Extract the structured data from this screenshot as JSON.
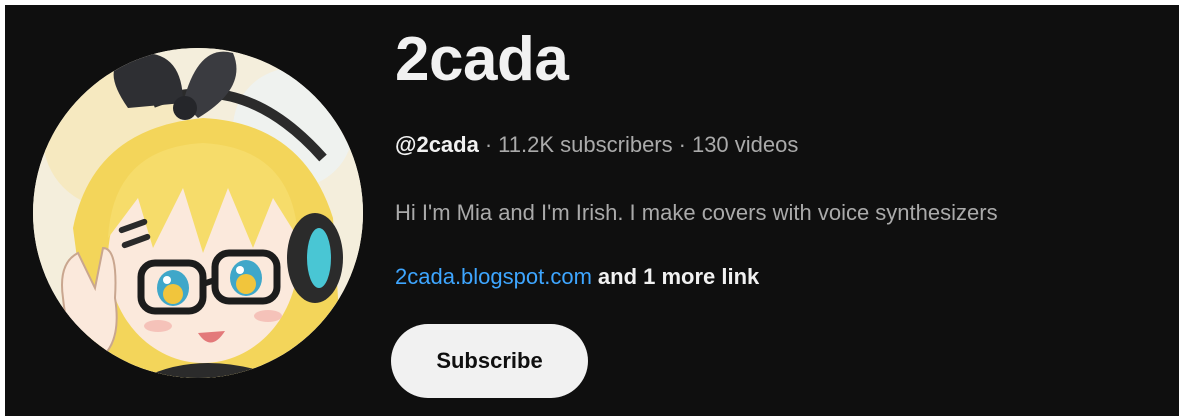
{
  "channel": {
    "name": "2cada",
    "handle": "@2cada",
    "separator": "·",
    "subscribers": "11.2K subscribers",
    "videos": "130 videos",
    "description": "Hi I'm Mia and I'm Irish. I make covers with voice synthesizers",
    "link_text": "2cada.blogspot.com",
    "more_links_text": "and 1 more link",
    "subscribe_label": "Subscribe",
    "avatar": "anime-girl-avatar"
  },
  "colors": {
    "background": "#0f0f0f",
    "primary_text": "#f1f1f1",
    "secondary_text": "#aaaaaa",
    "link": "#3ea6ff",
    "button_bg": "#f1f1f1",
    "button_text": "#0f0f0f"
  }
}
